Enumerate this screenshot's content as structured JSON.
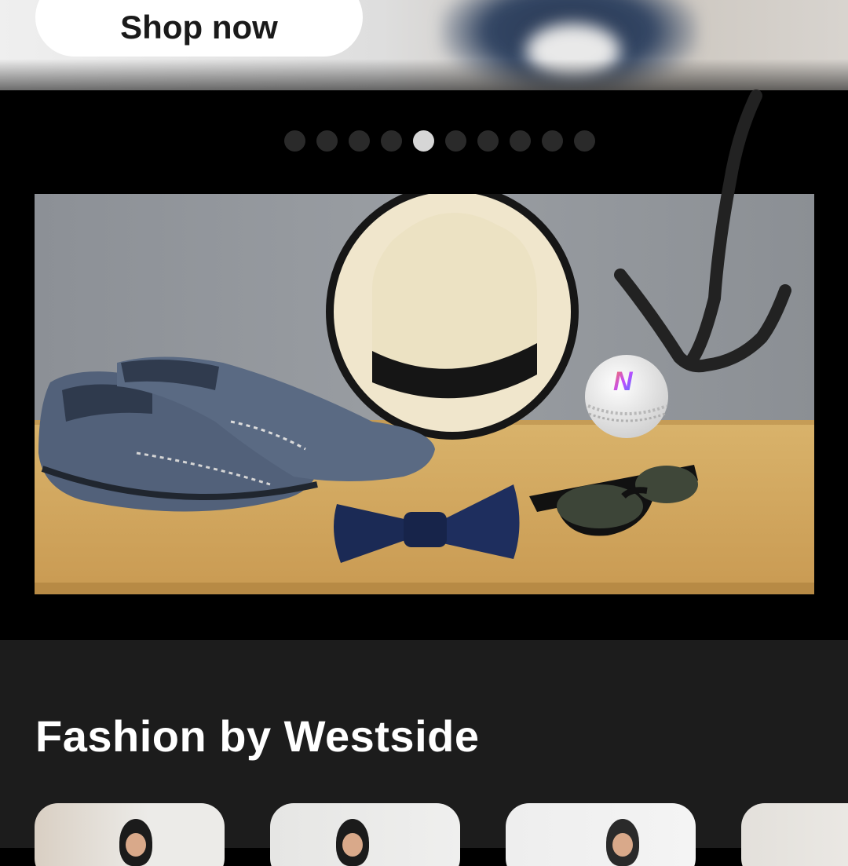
{
  "hero": {
    "shop_button_label": "Shop now"
  },
  "carousel": {
    "dot_count": 10,
    "active_index": 4
  },
  "banner": {
    "description_icon": "fashion-accessories-image",
    "ball_logo_letter": "N"
  },
  "section": {
    "title": "Fashion by Westside",
    "cards": [
      "fashion-card-1",
      "fashion-card-2",
      "fashion-card-3",
      "fashion-card-4"
    ]
  },
  "colors": {
    "background": "#000000",
    "section_bg": "#1c1c1c",
    "dot_active": "#d6d6d6",
    "dot_inactive": "#2a2a2a"
  }
}
